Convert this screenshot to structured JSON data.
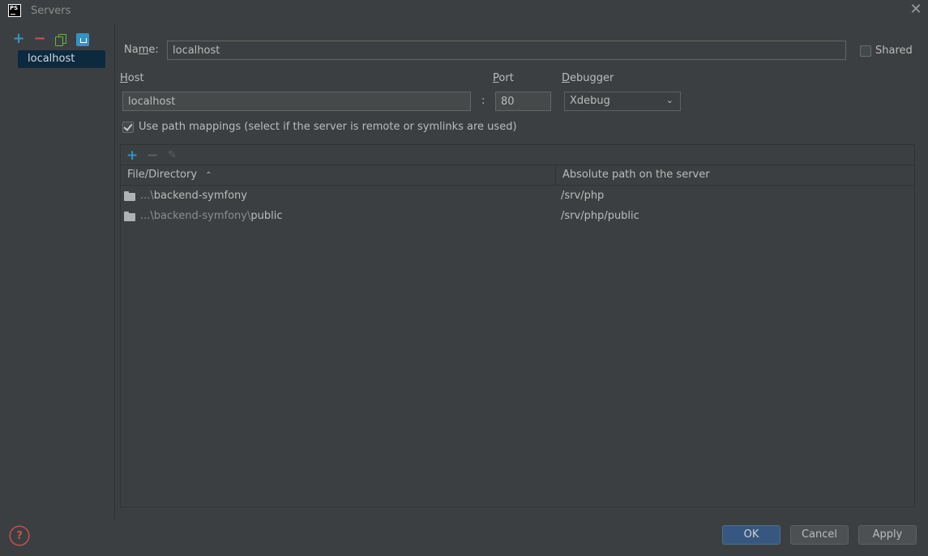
{
  "window": {
    "title": "Servers",
    "app_logo_text": "PS"
  },
  "sidebar": {
    "toolbar": [
      "add-icon",
      "remove-icon",
      "copy-icon",
      "export-icon"
    ],
    "items": [
      {
        "label": "localhost",
        "selected": true
      }
    ]
  },
  "form": {
    "name_label_pre": "Na",
    "name_label_u": "m",
    "name_label_post": "e:",
    "name_value": "localhost",
    "shared_label": "Shared",
    "shared_checked": false,
    "host_label_u": "H",
    "host_label_post": "ost",
    "host_value": "localhost",
    "colon": ":",
    "port_label_u": "P",
    "port_label_post": "ort",
    "port_value": "80",
    "debugger_label_u": "D",
    "debugger_label_post": "ebugger",
    "debugger_value": "Xdebug",
    "path_mappings_label": "Use path mappings (select if the server is remote or symlinks are used)",
    "path_mappings_checked": true
  },
  "mappings": {
    "toolbar": [
      "add-icon",
      "remove-icon",
      "edit-icon"
    ],
    "columns": [
      "File/Directory",
      "Absolute path on the server"
    ],
    "sort_indicator": "^",
    "rows": [
      {
        "prefix": "...\\",
        "name": "backend-symfony",
        "server_path": "/srv/php"
      },
      {
        "prefix": "...\\backend-symfony\\",
        "name": "public",
        "server_path": "/srv/php/public"
      }
    ]
  },
  "footer": {
    "ok_label": "OK",
    "cancel_label": "Cancel",
    "apply_label": "Apply",
    "help_symbol": "?"
  },
  "colors": {
    "background": "#3c3f41",
    "selection": "#0d293e",
    "accent_blue": "#3592c4",
    "primary_button": "#365880"
  }
}
